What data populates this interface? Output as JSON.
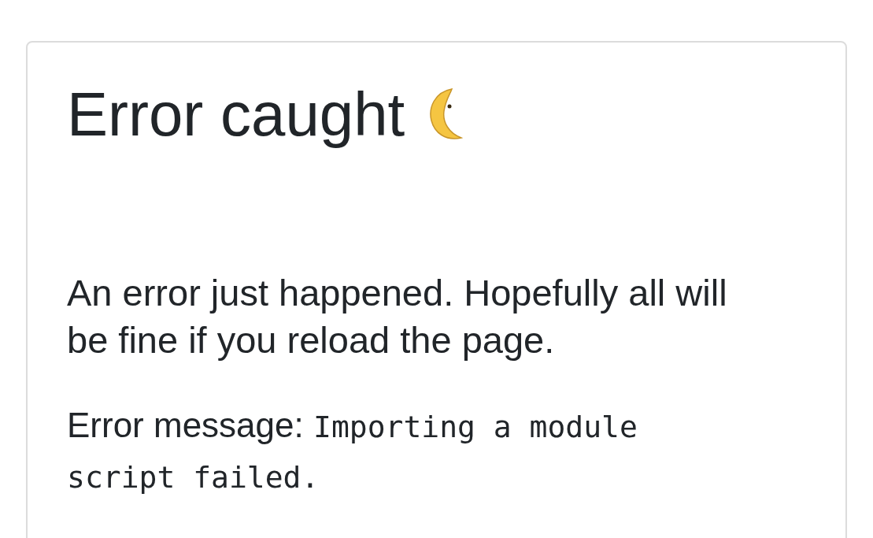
{
  "card": {
    "title": "Error caught",
    "message": "An error just happened. Hopefully all will be fine if you reload the page.",
    "error_label": "Error message:",
    "error_text": "Importing a module script failed."
  }
}
